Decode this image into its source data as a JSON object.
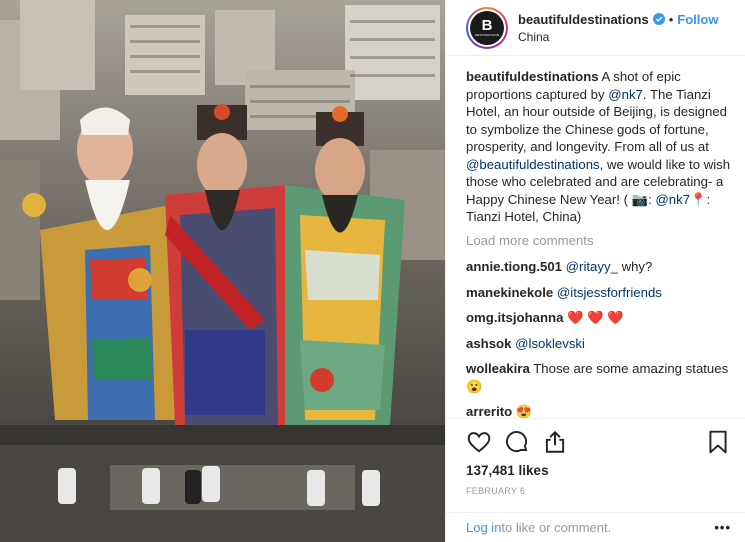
{
  "post": {
    "photo_alt": "",
    "header": {
      "username": "beautifuldestinations",
      "follow_label": "Follow",
      "separator": "•",
      "location": "China",
      "avatar_letter": "B",
      "avatar_small_text": "DESTINATIONS"
    },
    "caption": {
      "username": "beautifuldestinations",
      "text_1": " A shot of epic proportions captured by ",
      "mention_1": "@nk7",
      "text_2": ". The Tianzi Hotel, an hour outside of Beijing, is designed to symbolize the Chinese gods of fortune, prosperity, and longevity. From all of us at ",
      "mention_2": "@beautifuldestinations",
      "text_3": ", we would like to wish those who celebrated and are celebrating- a Happy Chinese New Year! ( ",
      "emoji_camera": "📷",
      "text_4": ": ",
      "mention_3": "@nk7",
      "emoji_pin": "📍",
      "text_5": ": Tianzi Hotel, China)"
    },
    "load_more_label": "Load more comments",
    "comments": [
      {
        "user": "annie.tiong.501",
        "mention": "@ritayy_",
        "text": " why?"
      },
      {
        "user": "manekinekole",
        "mention": "@itsjessforfriends",
        "text": ""
      },
      {
        "user": "omg.itsjohanna",
        "mention": "",
        "text": " ❤️ ❤️ ❤️"
      },
      {
        "user": "ashsok",
        "mention": "@lsoklevski",
        "text": ""
      },
      {
        "user": "wolleakira",
        "mention": "",
        "text": " Those are some amazing statues 😮"
      },
      {
        "user": "arrerito",
        "mention": "",
        "text": " 😍"
      }
    ],
    "likes": "137,481 likes",
    "date": "FEBRUARY 6",
    "login_link": "Log in",
    "login_text": " to like or comment.",
    "more_label": "•••",
    "icons": [
      "heart-icon",
      "comment-icon",
      "share-icon",
      "bookmark-icon",
      "verified-badge-icon"
    ],
    "colors": {
      "link": "#3897f0",
      "mention": "#003569",
      "muted": "#999999",
      "heart": "#ed4956"
    }
  }
}
